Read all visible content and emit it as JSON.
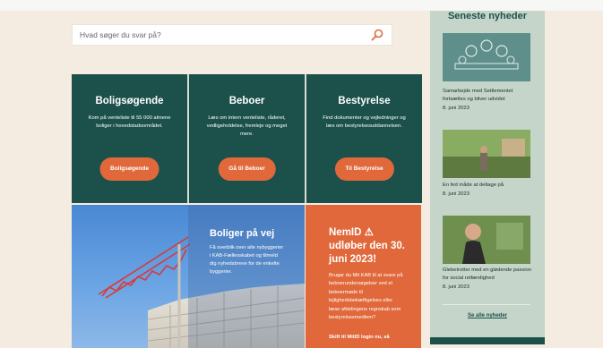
{
  "search": {
    "placeholder": "Hvad søger du svar på?"
  },
  "tiles": [
    {
      "title": "Boligsøgende",
      "text": "Kom på venteliste til 55 000 almene boliger i hovedstadsområdet.",
      "button": "Boligsøgende"
    },
    {
      "title": "Beboer",
      "text": "Læs om intern venteliste, råderet, vedligeholdelse, fremleje og meget mere.",
      "button": "Gå til Beboer"
    },
    {
      "title": "Bestyrelse",
      "text": "Find dokumenter og vejledninger og læs om bestyrelsesuddannelsen.",
      "button": "Til Bestyrelse"
    }
  ],
  "feature": {
    "title": "Boliger på vej",
    "text": "Få overblik over alle nybyggerier i KAB-Fællesskabet og tilmeld dig nyhedsbreve for de enkelte byggerier."
  },
  "notice": {
    "title": "NemID ⚠ udløber den 30. juni 2023!",
    "text": "Brugar du Mit KAB til at svare på beboerundersøgelser ved et beboermøde til lejlighedsbekæftigelses eller læse afdelingens regnskab som bestyrelsesmedlem?",
    "link": "Skift til MitID login nu, så"
  },
  "sidebar": {
    "heading": "Seneste nyheder",
    "news": [
      {
        "title": "Samarbejde med Settlementet fortsættes og bliver udvidet",
        "date": "8. juni 2023"
      },
      {
        "title": "En fed måde at deltage på",
        "date": "8. juni 2023"
      },
      {
        "title": "Glebetrotter med en glødende passion for social retfærdighed",
        "date": "8. juni 2023"
      }
    ],
    "all_link": "Se alle nyheder"
  },
  "colors": {
    "green": "#1c514b",
    "orange": "#e0683a",
    "sidebar": "#c5d5c9",
    "background": "#f5ece1"
  }
}
